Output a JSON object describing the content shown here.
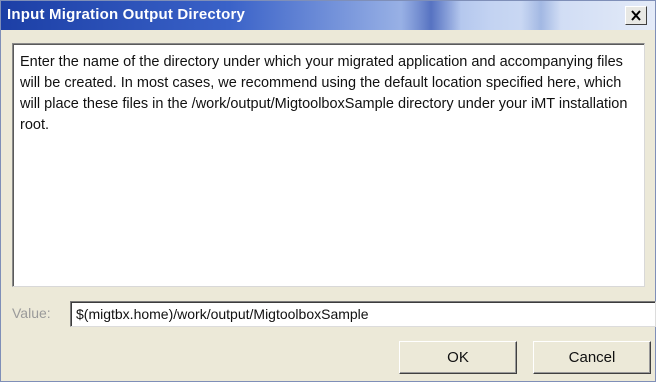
{
  "dialog": {
    "title": "Input Migration Output Directory",
    "close_icon": "close-icon",
    "message": "Enter the name of the directory under which your migrated application and accompanying files will be created.  In most cases, we recommend using the default location specified here, which will place these files in the /work/output/MigtoolboxSample directory under your iMT installation root.",
    "value_label": "Value:",
    "value": "$(migtbx.home)/work/output/MigtoolboxSample",
    "ok_label": "OK",
    "cancel_label": "Cancel"
  }
}
